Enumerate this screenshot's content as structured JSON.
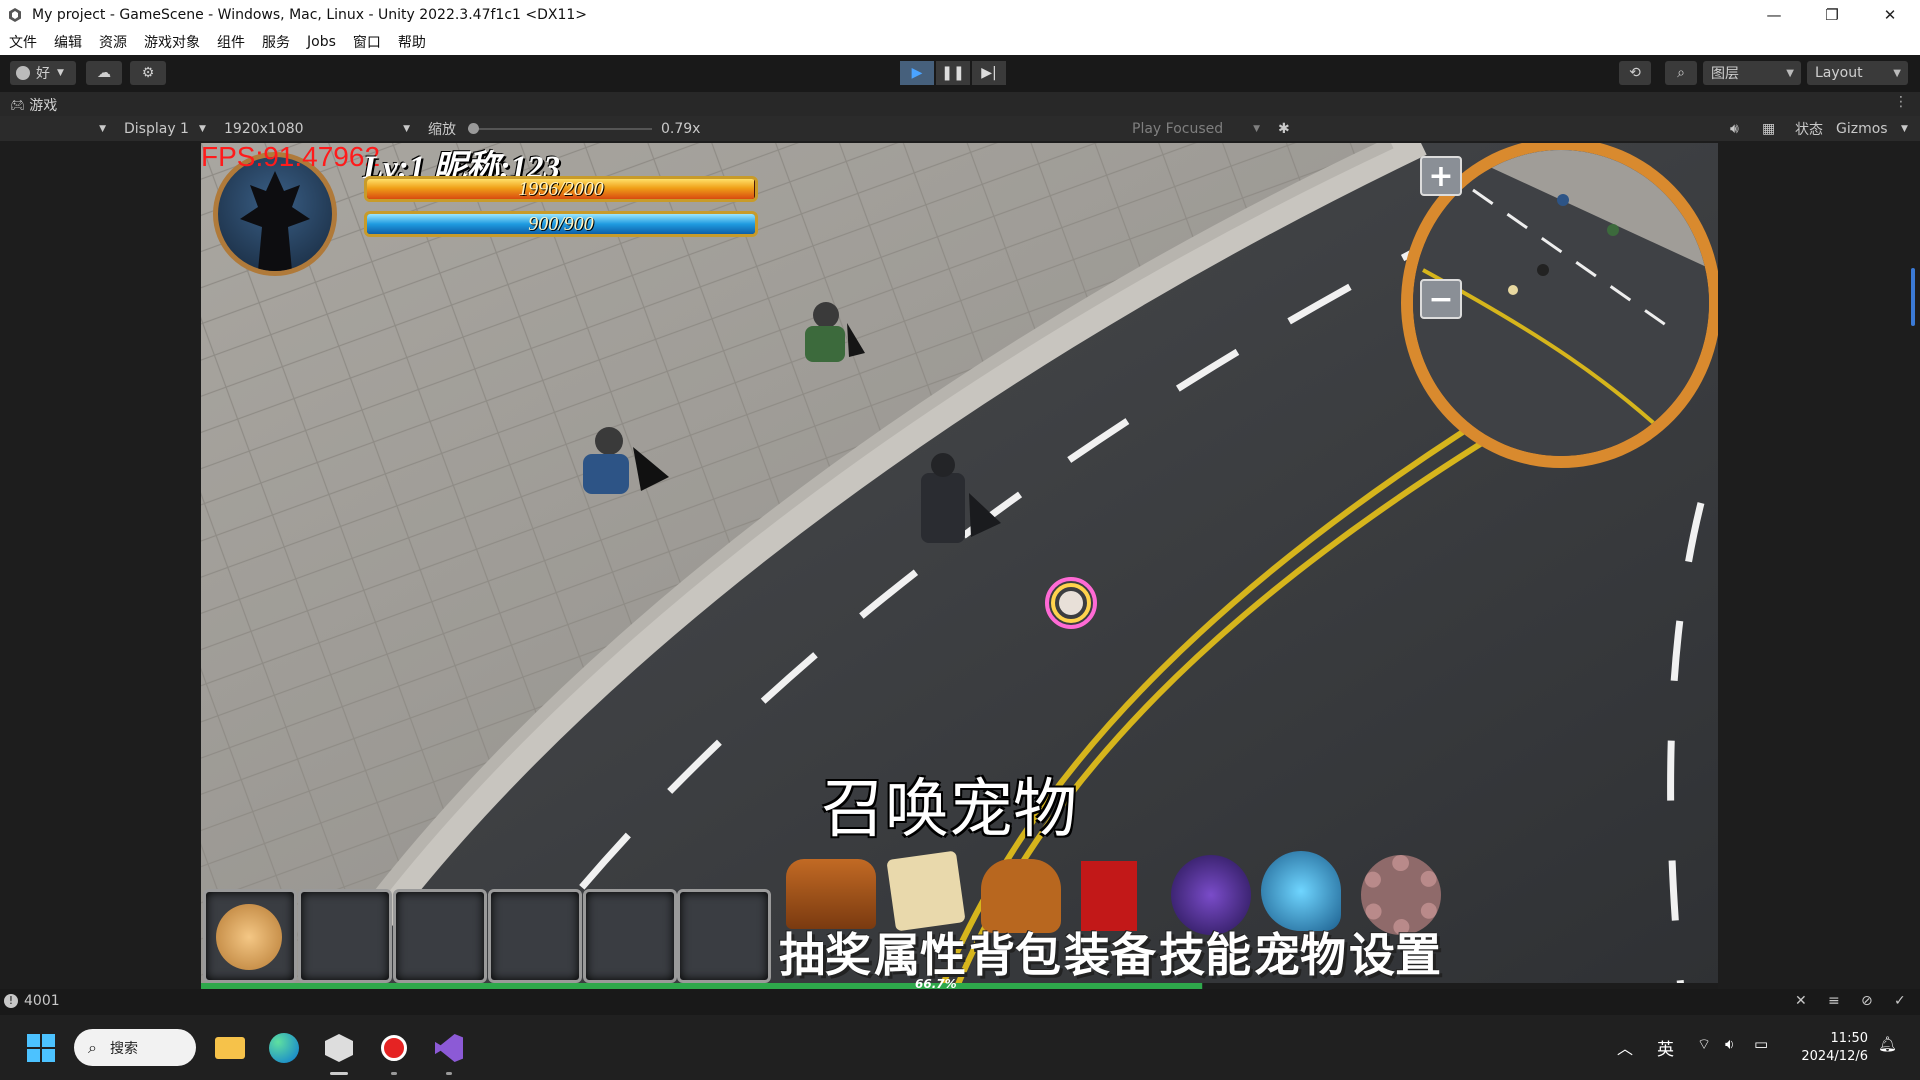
{
  "window": {
    "title": "My project - GameScene - Windows, Mac, Linux - Unity 2022.3.47f1c1 <DX11>",
    "controls": [
      "—",
      "❐",
      "✕"
    ]
  },
  "menu": [
    "文件",
    "编辑",
    "资源",
    "游戏对象",
    "组件",
    "服务",
    "Jobs",
    "窗口",
    "帮助"
  ],
  "toolbar": {
    "account_label": "好",
    "layers_label": "图层",
    "layout_label": "Layout"
  },
  "game_tab": {
    "label": "游戏"
  },
  "game_bar": {
    "display": "Display 1",
    "resolution": "1920x1080",
    "scale_label": "缩放",
    "scale_value": "0.79x",
    "scale_fraction": 0.0,
    "play_mode": "Play Focused",
    "stats_label": "状态",
    "gizmos_label": "Gizmos"
  },
  "hud": {
    "fps": "FPS:91.47962",
    "level_name": "Lv:1  昵称:123",
    "hp": {
      "text": "1996/2000",
      "fraction": 0.998
    },
    "mp": {
      "text": "900/900",
      "fraction": 1.0
    },
    "center_text": "召唤宠物",
    "exp_text": "66.7%",
    "exp_fraction": 0.66,
    "menu_labels": [
      "抽奖",
      "属性",
      "背包",
      "装备",
      "技能",
      "宠物",
      "设置"
    ],
    "minimap_plus": "+",
    "minimap_minus": "−"
  },
  "status": {
    "count": "4001"
  },
  "taskbar": {
    "search": "搜索",
    "ime": "英",
    "time": "11:50",
    "date": "2024/12/6"
  },
  "colors": {
    "accent": "#4aa3ff",
    "fps": "#ff1b1b",
    "hp": "#f0a018",
    "mp": "#1f9be0",
    "minimap_ring": "#d98a2e"
  }
}
